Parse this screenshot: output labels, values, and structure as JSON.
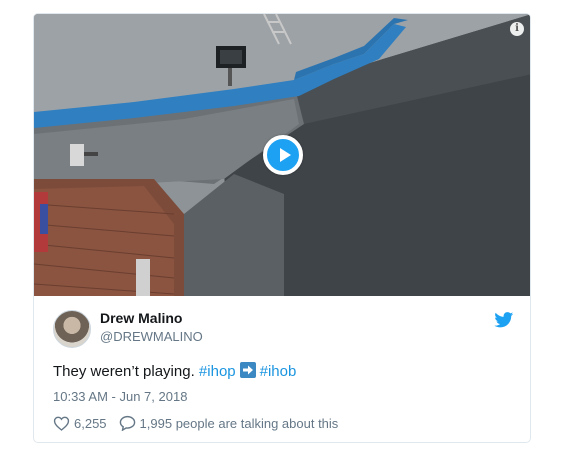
{
  "media": {
    "info_icon": "info-icon",
    "play_icon": "play-icon"
  },
  "author": {
    "name": "Drew Malino",
    "handle": "@DREWMALINO"
  },
  "tweet": {
    "text_prefix": "They weren’t playing.",
    "hashtag_1": "#ihop",
    "emoji": "right-arrow-emoji",
    "hashtag_2": "#ihob"
  },
  "timestamp": "10:33 AM - Jun 7, 2018",
  "actions": {
    "likes": "6,255",
    "talking": "1,995 people are talking about this"
  },
  "colors": {
    "accent": "#1da1f2",
    "hashtag": "#1b95e0",
    "secondary_text": "#657786"
  }
}
